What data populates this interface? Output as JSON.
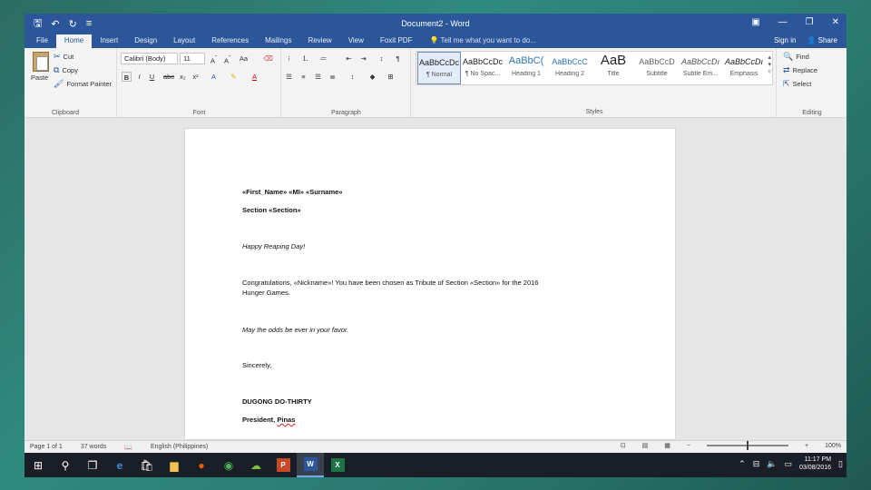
{
  "window": {
    "title": "Document2 - Word",
    "qat": {
      "save_icon": "save-icon",
      "undo_icon": "undo-icon",
      "redo_icon": "redo-icon",
      "customize_icon": "customize-icon"
    },
    "controls": {
      "ribbon_display": "ribbon-display-icon",
      "minimize": "minimize-icon",
      "maximize": "maximize-icon",
      "close": "close-icon"
    }
  },
  "tabs": [
    "File",
    "Home",
    "Insert",
    "Design",
    "Layout",
    "References",
    "Mailings",
    "Review",
    "View",
    "Foxit PDF"
  ],
  "active_tab": "Home",
  "tell_me": "Tell me what you want to do...",
  "sign_in": "Sign in",
  "share": "Share",
  "ribbon": {
    "clipboard": {
      "paste": "Paste",
      "cut": "Cut",
      "copy": "Copy",
      "format_painter": "Format Painter",
      "label": "Clipboard"
    },
    "font": {
      "name": "Calibri (Body)",
      "size": "11",
      "label": "Font"
    },
    "paragraph": {
      "label": "Paragraph"
    },
    "styles": {
      "label": "Styles",
      "items": [
        {
          "preview": "AaBbCcDc",
          "name": "¶ Normal"
        },
        {
          "preview": "AaBbCcDc",
          "name": "¶ No Spac..."
        },
        {
          "preview": "AaBbC(",
          "name": "Heading 1"
        },
        {
          "preview": "AaBbCcC",
          "name": "Heading 2"
        },
        {
          "preview": "AaB",
          "name": "Title"
        },
        {
          "preview": "AaBbCcD",
          "name": "Subtitle"
        },
        {
          "preview": "AaBbCcDı",
          "name": "Subtle Em..."
        },
        {
          "preview": "AaBbCcDı",
          "name": "Emphasis"
        }
      ]
    },
    "editing": {
      "find": "Find",
      "replace": "Replace",
      "select": "Select",
      "label": "Editing"
    }
  },
  "document": {
    "lines": [
      {
        "text": "«First_Name» «MI» «Surname»",
        "style": "bold"
      },
      {
        "text": "Section «Section»",
        "style": "bold"
      },
      {
        "text": "Happy Reaping Day!",
        "style": "italic"
      },
      {
        "text": "Congratulations, «Nickname»! You have been chosen as Tribute of Section «Section» for the 2016",
        "style": "normal"
      },
      {
        "text": "Hunger Games.",
        "style": "normal"
      },
      {
        "text": "May the odds be ever in your favor.",
        "style": "italic"
      },
      {
        "text": "Sincerely,",
        "style": "normal"
      },
      {
        "text": "DUGONG DO-THIRTY",
        "style": "bold"
      },
      {
        "text_pre": "President, ",
        "text_err": "Pinas",
        "style": "bold"
      }
    ]
  },
  "status": {
    "page": "Page 1 of 1",
    "words": "37 words",
    "language": "English (Philippines)",
    "zoom": "100%"
  },
  "taskbar": {
    "time": "11:17 PM",
    "date": "03/08/2016"
  }
}
